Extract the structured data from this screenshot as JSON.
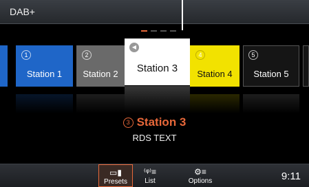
{
  "header": {
    "title": "DAB+"
  },
  "carousel": {
    "stations": [
      {
        "number": "1",
        "label": "Station 1",
        "color": "#1f66c8"
      },
      {
        "number": "2",
        "label": "Station 2",
        "color": "#6a6a6a"
      },
      {
        "number": "",
        "label": "Station 3",
        "color": "#ffffff",
        "icon": "speaker-icon"
      },
      {
        "number": "4",
        "label": "Station 4",
        "color": "#f2e200"
      },
      {
        "number": "5",
        "label": "Station 5",
        "color": "#1a1a1a"
      }
    ]
  },
  "now_playing": {
    "preset_number": "3",
    "station": "Station 3",
    "rds": "RDS TEXT",
    "accent": "#e8683a"
  },
  "bottom_nav": {
    "items": [
      {
        "label": "Presets",
        "icon": "presets-icon",
        "active": true
      },
      {
        "label": "List",
        "icon": "antenna-list-icon",
        "active": false
      },
      {
        "label": "Options",
        "icon": "options-icon",
        "active": false
      }
    ],
    "clock": "9:11"
  }
}
